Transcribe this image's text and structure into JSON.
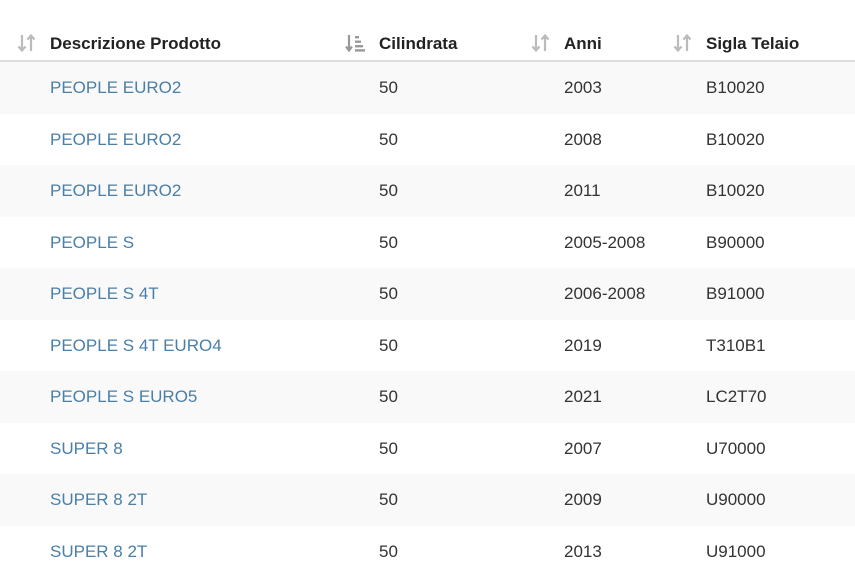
{
  "table": {
    "columns": [
      {
        "label": "Descrizione Prodotto",
        "sort_icon": "sort-neutral-icon"
      },
      {
        "label": "Cilindrata",
        "sort_icon": "sort-amount-down-icon"
      },
      {
        "label": "Anni",
        "sort_icon": "sort-neutral-icon"
      },
      {
        "label": "Sigla Telaio",
        "sort_icon": "sort-neutral-icon"
      }
    ],
    "rows": [
      {
        "descrizione": "PEOPLE EURO2",
        "cilindrata": "50",
        "anni": "2003",
        "sigla": "B10020"
      },
      {
        "descrizione": "PEOPLE EURO2",
        "cilindrata": "50",
        "anni": "2008",
        "sigla": "B10020"
      },
      {
        "descrizione": "PEOPLE EURO2",
        "cilindrata": "50",
        "anni": "2011",
        "sigla": "B10020"
      },
      {
        "descrizione": "PEOPLE S",
        "cilindrata": "50",
        "anni": "2005-2008",
        "sigla": "B90000"
      },
      {
        "descrizione": "PEOPLE S 4T",
        "cilindrata": "50",
        "anni": "2006-2008",
        "sigla": "B91000"
      },
      {
        "descrizione": "PEOPLE S 4T EURO4",
        "cilindrata": "50",
        "anni": "2019",
        "sigla": "T310B1"
      },
      {
        "descrizione": "PEOPLE S EURO5",
        "cilindrata": "50",
        "anni": "2021",
        "sigla": "LC2T70"
      },
      {
        "descrizione": "SUPER 8",
        "cilindrata": "50",
        "anni": "2007",
        "sigla": "U70000"
      },
      {
        "descrizione": "SUPER 8 2T",
        "cilindrata": "50",
        "anni": "2009",
        "sigla": "U90000"
      },
      {
        "descrizione": "SUPER 8 2T",
        "cilindrata": "50",
        "anni": "2013",
        "sigla": "U91000"
      }
    ]
  },
  "colors": {
    "link": "#4a7fa8",
    "text": "#333333",
    "stripe": "#f9f9f9",
    "icon": "#bbbbbb"
  }
}
